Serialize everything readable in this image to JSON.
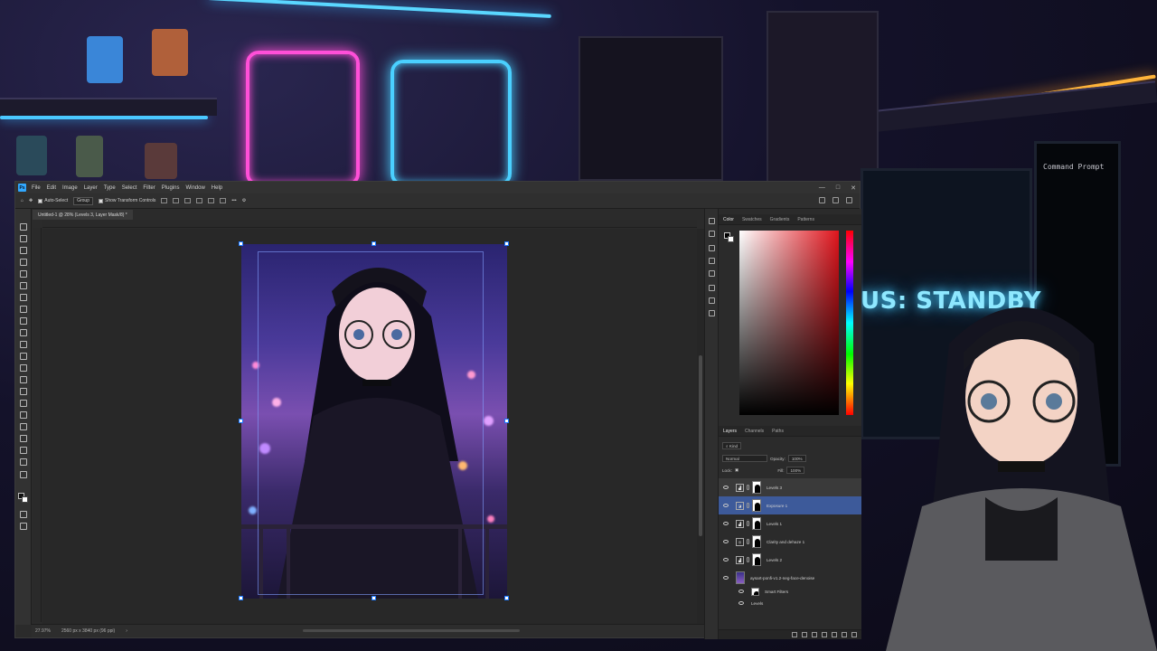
{
  "menu": {
    "app_icon": "Ps",
    "items": [
      "File",
      "Edit",
      "Image",
      "Layer",
      "Type",
      "Select",
      "Filter",
      "Plugins",
      "Window",
      "Help"
    ],
    "window_controls": [
      "minimize-icon",
      "maximize-icon",
      "close-icon"
    ]
  },
  "options": {
    "auto_select_label": "Auto-Select",
    "auto_select_value": "Group",
    "show_transform_label": "Show Transform Controls",
    "more_label": "•••"
  },
  "document": {
    "tab_title": "Untitled-1 @ 28% (Levels 3, Layer Mask/8) *"
  },
  "status": {
    "zoom": "27.97%",
    "doc_size": "2560 px x 3840 px (96 ppi)"
  },
  "panels": {
    "color_tabs": [
      "Color",
      "Swatches",
      "Gradients",
      "Patterns"
    ],
    "layer_tabs": [
      "Layers",
      "Channels",
      "Paths"
    ],
    "kind_label": "Kind",
    "blend_mode": "Normal",
    "opacity_label": "Opacity:",
    "opacity_value": "100%",
    "lock_label": "Lock:",
    "fill_label": "Fill:",
    "fill_value": "100%"
  },
  "layers": [
    {
      "name": "Levels 3",
      "type": "levels-icon",
      "state": "highlighted"
    },
    {
      "name": "Exposure 1",
      "type": "exposure-icon",
      "state": "selected"
    },
    {
      "name": "Levels 1",
      "type": "levels-icon",
      "state": "normal"
    },
    {
      "name": "Clarity and dehaze 1",
      "type": "clarity-icon",
      "state": "normal"
    },
    {
      "name": "Levels 2",
      "type": "levels-icon",
      "state": "normal"
    },
    {
      "name": "aysart-ponfi-v1.2-neg-face-denoise",
      "type": "smart-object",
      "state": "normal"
    }
  ],
  "smart_filters": {
    "label": "Smart Filters",
    "filter": "Levels"
  },
  "background": {
    "monitor_text": "US: STANDBY",
    "terminal_title": "Command Prompt"
  },
  "colors": {
    "selection": "#3d5a9a",
    "accent_blue": "#31a8ff",
    "neon_pink": "#ff4fd8",
    "neon_cyan": "#4ad0ff"
  }
}
